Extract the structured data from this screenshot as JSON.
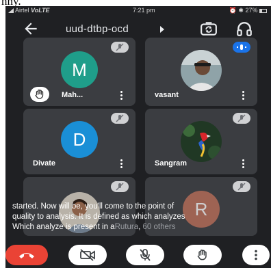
{
  "top_fragment": "nny.",
  "status": {
    "carrier": "Airtel",
    "network": "VoLTE",
    "time": "7:21 pm",
    "battery": "27%",
    "icons": [
      "signal-icon",
      "alarm-icon",
      "bluetooth-icon",
      "battery-icon"
    ]
  },
  "header": {
    "back_icon": "arrow-left-icon",
    "title": "uud-dtbp-ocd",
    "caret_icon": "caret-right-icon",
    "switch_camera_icon": "switch-camera-icon",
    "audio_icon": "headset-icon"
  },
  "participants": [
    {
      "name": "Mah...",
      "avatar": "M",
      "avatar_color": "#1f9e8a",
      "muted": true,
      "hand_raised": true
    },
    {
      "name": "vasant",
      "avatar": "photo",
      "muted": false,
      "speaking": true
    },
    {
      "name": "Divate",
      "avatar": "D",
      "avatar_color": "#1a8fd6",
      "muted": true
    },
    {
      "name": "Sangram",
      "avatar": "photo-parrot",
      "muted": true
    },
    {
      "name": "",
      "avatar": "photo",
      "muted": true
    },
    {
      "name": "Rutura",
      "avatar": "R",
      "avatar_color": "#c0705a",
      "muted": true,
      "others_label": "60 others"
    }
  ],
  "captions": {
    "line1": "started. Now will be, you'll come to the point of",
    "line2": "quality to analysis. It is defined as which analyzes",
    "line3": "Which analyze is present in a"
  },
  "controls": {
    "items": [
      "end-call-icon",
      "camera-off-icon",
      "mic-off-icon",
      "raise-hand-icon",
      "more-options-icon"
    ],
    "colors": {
      "end_call": "#ea4335",
      "control_bg": "#ffffff",
      "app_bg": "#1f2023",
      "tile_bg": "#3b3d41"
    }
  }
}
